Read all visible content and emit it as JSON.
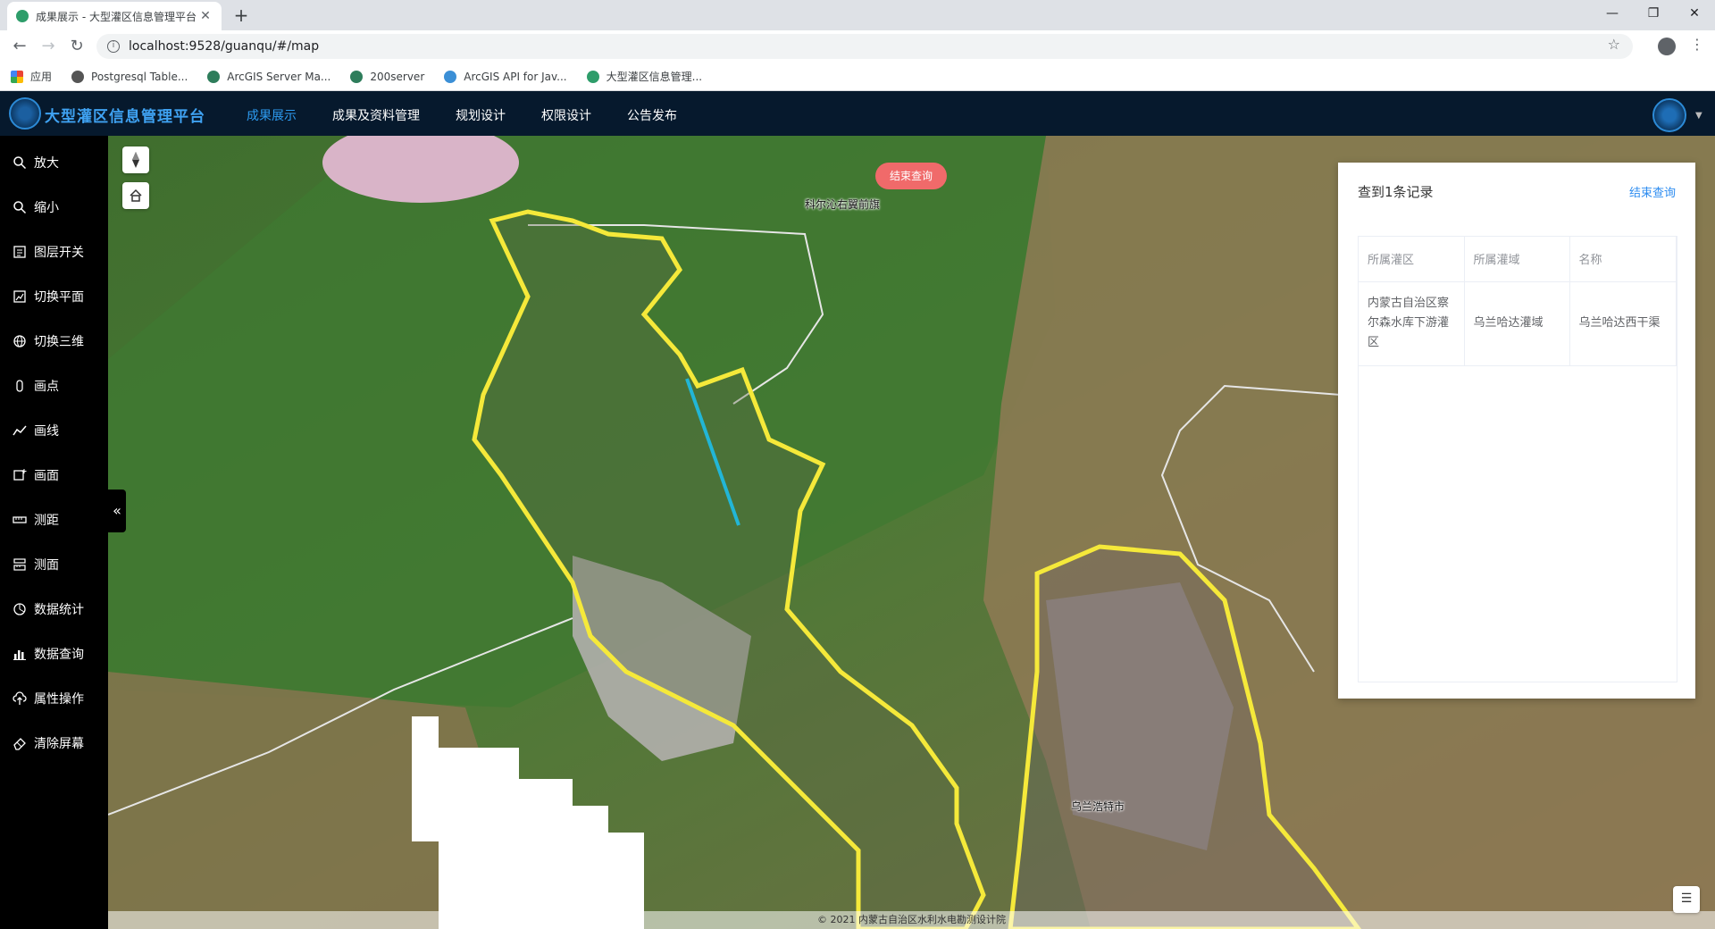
{
  "browser": {
    "tab_title": "成果展示 - 大型灌区信息管理平台",
    "url": "localhost:9528/guanqu/#/map",
    "bookmarks": [
      {
        "label": "应用"
      },
      {
        "label": "Postgresql Table..."
      },
      {
        "label": "ArcGIS Server Ma..."
      },
      {
        "label": "200server"
      },
      {
        "label": "ArcGIS API for Jav..."
      },
      {
        "label": "大型灌区信息管理..."
      }
    ]
  },
  "app": {
    "title": "大型灌区信息管理平台",
    "nav": [
      {
        "label": "成果展示",
        "active": true
      },
      {
        "label": "成果及资料管理"
      },
      {
        "label": "规划设计"
      },
      {
        "label": "权限设计"
      },
      {
        "label": "公告发布"
      }
    ]
  },
  "sidebar": {
    "tools": [
      {
        "label": "放大",
        "icon": "zoom-in-icon"
      },
      {
        "label": "缩小",
        "icon": "zoom-out-icon"
      },
      {
        "label": "图层开关",
        "icon": "layers-icon"
      },
      {
        "label": "切换平面",
        "icon": "map-2d-icon"
      },
      {
        "label": "切换三维",
        "icon": "globe-3d-icon"
      },
      {
        "label": "画点",
        "icon": "point-icon"
      },
      {
        "label": "画线",
        "icon": "polyline-icon"
      },
      {
        "label": "画面",
        "icon": "polygon-icon"
      },
      {
        "label": "测距",
        "icon": "ruler-icon"
      },
      {
        "label": "测面",
        "icon": "area-measure-icon"
      },
      {
        "label": "数据统计",
        "icon": "statistics-icon"
      },
      {
        "label": "数据查询",
        "icon": "bar-chart-icon"
      },
      {
        "label": "属性操作",
        "icon": "upload-cloud-icon"
      },
      {
        "label": "清除屏幕",
        "icon": "eraser-icon"
      }
    ]
  },
  "map": {
    "end_query_button": "结束查询",
    "labels": {
      "north_town": "科尔沁右翼前旗",
      "city": "乌兰浩特市"
    },
    "attribution": "© 2021 内蒙古自治区水利水电勘测设计院"
  },
  "results_panel": {
    "header": "查到1条记录",
    "close_label": "结束查询",
    "columns": [
      "所属灌区",
      "所属灌域",
      "名称"
    ],
    "rows": [
      [
        "内蒙古自治区察尔森水库下游灌区",
        "乌兰哈达灌域",
        "乌兰哈达西干渠"
      ]
    ]
  },
  "colors": {
    "header_bg": "#06192d",
    "active_nav": "#2d9bf0",
    "boundary": "#f5e93a",
    "canal": "#22b6d6",
    "end_query_bg": "#f06a6a"
  }
}
